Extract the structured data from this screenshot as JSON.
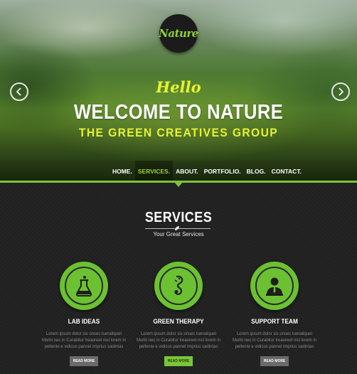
{
  "colors": {
    "accent": "#7cc43a",
    "title_yellow": "#e8f52e",
    "dark_bg": "#222222"
  },
  "logo": {
    "text": "Nature"
  },
  "hero": {
    "greeting": "Hello",
    "title": "WELCOME TO NATURE",
    "subtitle": "THE GREEN CREATIVES GROUP",
    "prev_icon": "chevron-left-icon",
    "next_icon": "chevron-right-icon"
  },
  "nav": {
    "items": [
      {
        "label": "HOME.",
        "active": false
      },
      {
        "label": "SERVICES.",
        "active": true
      },
      {
        "label": "ABOUT.",
        "active": false
      },
      {
        "label": "PORTFOLIO.",
        "active": false
      },
      {
        "label": "BLOG.",
        "active": false
      },
      {
        "label": "CONTACT.",
        "active": false
      }
    ]
  },
  "services": {
    "title": "SERVICES",
    "subtitle": "Your Great Services",
    "cards": [
      {
        "icon": "flask-icon",
        "title": "LAB IDEAS",
        "text_line1": "Lorem ipsum dolor sis onsec  tueraliquet",
        "text_line2": "Morbi nec in Curabitur lreaoreet nisl lorem in",
        "text_line3": "pellente e vidicus pannel imprius sadintas",
        "button": "READ MORE",
        "button_highlighted": false
      },
      {
        "icon": "seahorse-icon",
        "title": "GREEN THERAPY",
        "text_line1": "Lorem ipsum dolor sis onsec  tueraliquet",
        "text_line2": "Morbi nec in Curabitur lreaoreet nisl lorem in",
        "text_line3": "pellente e vidicus pannel imprius sadintas",
        "button": "READ MORE",
        "button_highlighted": true
      },
      {
        "icon": "person-icon",
        "title": "SUPPORT TEAM",
        "text_line1": "Lorem ipsum dolor sis onsec  tueraliquet",
        "text_line2": "Morbi nec in Curabitur lreaoreet nisl lorem in",
        "text_line3": "pellente e vidicus pannel imprius sadintas",
        "button": "READ MORE",
        "button_highlighted": false
      }
    ]
  }
}
